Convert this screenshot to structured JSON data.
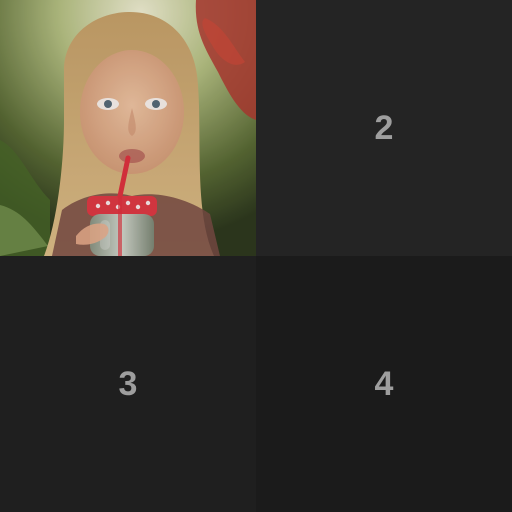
{
  "tiles": [
    {
      "id": 1,
      "type": "photo",
      "description_icon": "girl-drinking-from-jar-photo"
    },
    {
      "id": 2,
      "label": "2"
    },
    {
      "id": 3,
      "label": "3"
    },
    {
      "id": 4,
      "label": "4"
    }
  ],
  "colors": {
    "tile_bg_2": "#242424",
    "tile_bg_3": "#1f1f1f",
    "tile_bg_4": "#1b1b1b",
    "number_text": "#9e9e9e"
  }
}
